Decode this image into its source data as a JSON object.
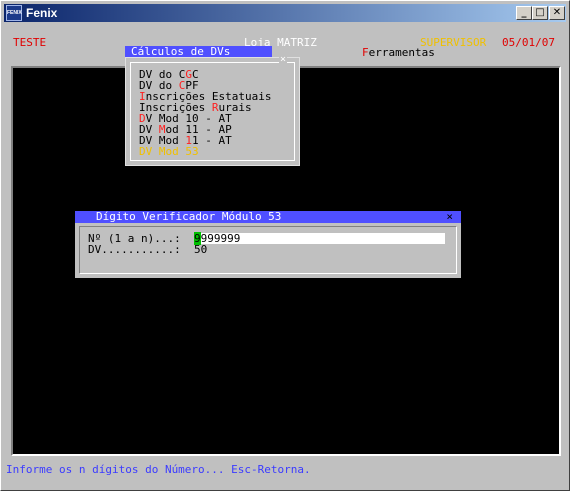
{
  "window": {
    "title": "Fenix",
    "icon_label": "FENIX",
    "minimize": "_",
    "maximize": "□",
    "close": "✕"
  },
  "header": {
    "company": "TESTE",
    "store": "Loja MATRIZ",
    "user": "SUPERVISOR",
    "date": "05/01/07",
    "menu_active": "Cálculos de DVs",
    "menu_tools_hotkey": "F",
    "menu_tools_rest": "erramentas"
  },
  "dropdown": {
    "close": "×",
    "items": [
      {
        "pre": "DV do C",
        "hk": "G",
        "post": "C"
      },
      {
        "pre": "DV do ",
        "hk": "C",
        "post": "PF"
      },
      {
        "pre": "",
        "hk": "I",
        "post": "nscrições Estatuais"
      },
      {
        "pre": "Inscrições ",
        "hk": "R",
        "post": "urais"
      },
      {
        "pre": "",
        "hk": "D",
        "post": "V Mod 10 - AT"
      },
      {
        "pre": "DV ",
        "hk": "M",
        "post": "od 11 - AP"
      },
      {
        "pre": "DV Mod ",
        "hk": "1",
        "post": "1 - AT"
      },
      {
        "pre": "",
        "hk": "",
        "post": "DV Mod 53"
      }
    ]
  },
  "dialog": {
    "title": "Dígito Verificador Módulo 53",
    "close": "×",
    "label_number": "Nº (1 a n)...:",
    "input_cursor": "9",
    "input_value": "999999",
    "label_dv": "DV...........:",
    "dv_value": "50"
  },
  "status": "Informe os n dígitos do Número... Esc-Retorna."
}
